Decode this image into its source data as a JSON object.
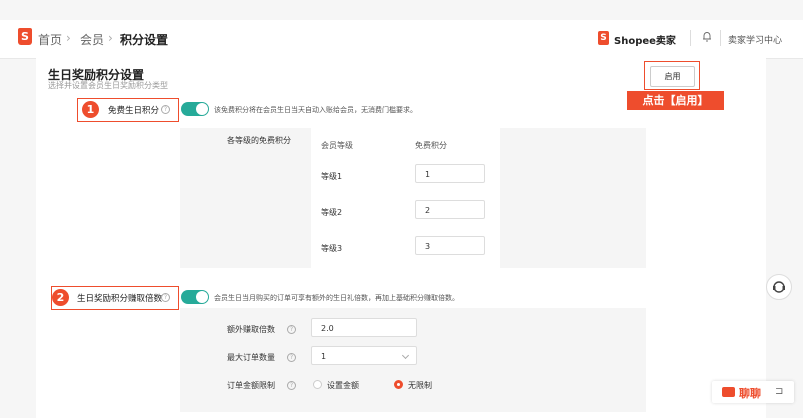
{
  "breadcrumb": {
    "home": "首页",
    "sep": "›",
    "member": "会员",
    "current": "积分设置"
  },
  "header": {
    "seller": "Shopee卖家",
    "learn": "卖家学习中心"
  },
  "page": {
    "title": "生日奖励积分设置",
    "subtitle": "选择并设置会员生日奖励积分类型",
    "enable_button": "启用",
    "callout": "点击【启用】"
  },
  "section1": {
    "badge": "1",
    "label": "免费生日积分",
    "toggle_on": true,
    "description": "该免费积分将在会员生日当天自动入账给会员，无消费门槛要求。",
    "table": {
      "row_label": "各等级的免费积分",
      "col_level": "会员等级",
      "col_points": "免费积分",
      "rows": [
        {
          "level": "等级1",
          "points": "1"
        },
        {
          "level": "等级2",
          "points": "2"
        },
        {
          "level": "等级3",
          "points": "3"
        }
      ]
    }
  },
  "section2": {
    "badge": "2",
    "label": "生日奖励积分赚取倍数",
    "toggle_on": true,
    "description": "会员生日当月购买的订单可享有额外的生日礼倍数，再加上基础积分赚取倍数。",
    "fields": {
      "multiplier_label": "额外赚取倍数",
      "multiplier_value": "2.0",
      "max_orders_label": "最大订单数量",
      "max_orders_value": "1",
      "amount_limit_label": "订单金额限制",
      "option_set": "设置金额",
      "option_unlimited": "无限制",
      "selected": "无限制"
    }
  },
  "chat": {
    "label": "聊聊"
  },
  "colors": {
    "accent": "#ee4d2d",
    "toggle": "#26aa99"
  }
}
